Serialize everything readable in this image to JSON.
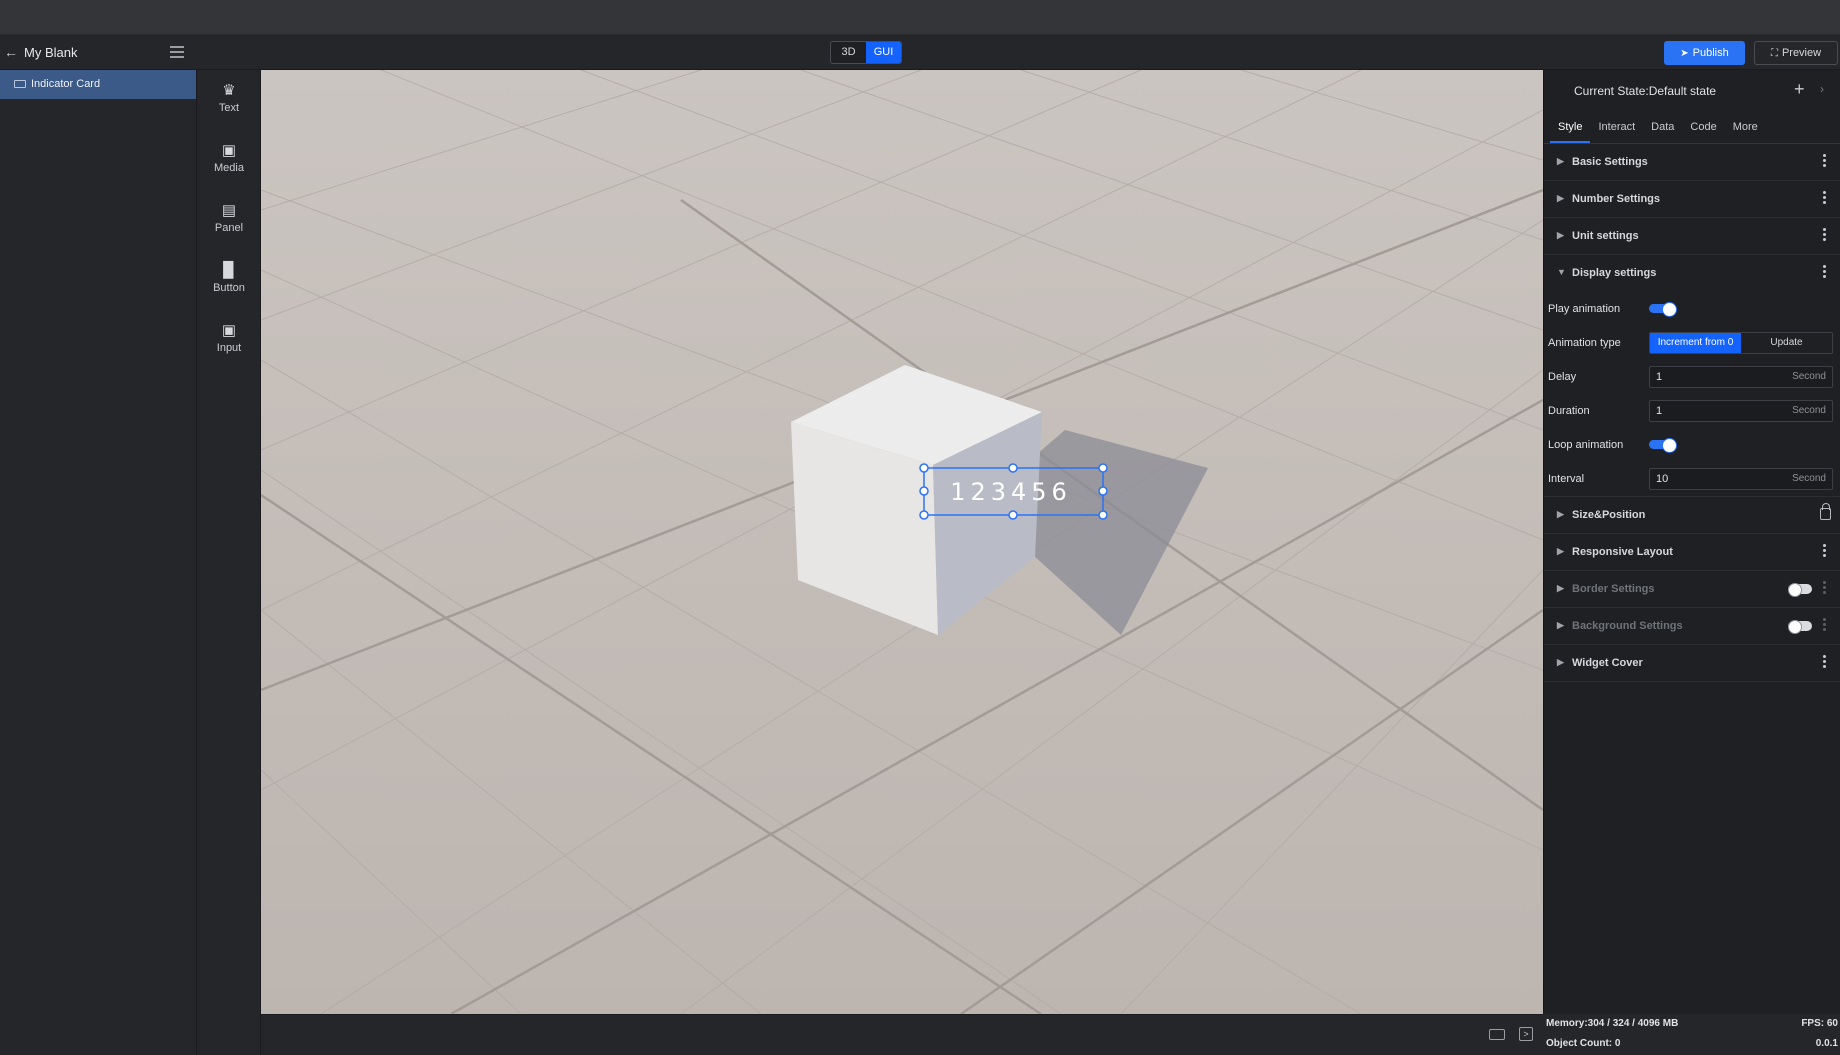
{
  "header": {
    "project_title": "My Blank",
    "mode_3d": "3D",
    "mode_gui": "GUI",
    "publish_label": "Publish",
    "preview_label": "Preview",
    "accent_color": "#1463ff"
  },
  "layers": {
    "items": [
      {
        "label": "Indicator Card",
        "selected": true
      }
    ]
  },
  "toolbox": {
    "items": [
      {
        "label": "Text",
        "icon": "text-icon"
      },
      {
        "label": "Media",
        "icon": "media-icon"
      },
      {
        "label": "Panel",
        "icon": "panel-icon"
      },
      {
        "label": "Button",
        "icon": "button-icon"
      },
      {
        "label": "Input",
        "icon": "input-icon"
      }
    ]
  },
  "viewport": {
    "widget_text": "123456"
  },
  "panel": {
    "current_state": "Current State:Default state",
    "tabs": [
      "Style",
      "Interact",
      "Data",
      "Code",
      "More"
    ],
    "active_tab": "Style",
    "sections_top": [
      {
        "title": "Basic Settings",
        "expanded": false
      },
      {
        "title": "Number Settings",
        "expanded": false
      },
      {
        "title": "Unit settings",
        "expanded": false
      },
      {
        "title": "Display settings",
        "expanded": true
      }
    ],
    "display": {
      "play_animation_label": "Play animation",
      "play_animation": true,
      "animation_type_label": "Animation type",
      "animation_type_options": [
        "Increment from 0",
        "Update"
      ],
      "animation_type_selected": "Increment from 0",
      "delay_label": "Delay",
      "delay_value": "1",
      "delay_unit": "Second",
      "duration_label": "Duration",
      "duration_value": "1",
      "duration_unit": "Second",
      "loop_animation_label": "Loop animation",
      "loop_animation": true,
      "interval_label": "Interval",
      "interval_value": "10",
      "interval_unit": "Second"
    },
    "sections_bottom": [
      {
        "title": "Size&Position",
        "locked": true
      },
      {
        "title": "Responsive Layout"
      },
      {
        "title": "Border Settings",
        "enabled": false
      },
      {
        "title": "Background Settings",
        "enabled": false
      },
      {
        "title": "Widget Cover"
      }
    ]
  },
  "status": {
    "memory": "Memory:304 / 324 / 4096 MB",
    "fps": "FPS: 60",
    "object_count": "Object Count: 0",
    "version": "0.0.1"
  }
}
